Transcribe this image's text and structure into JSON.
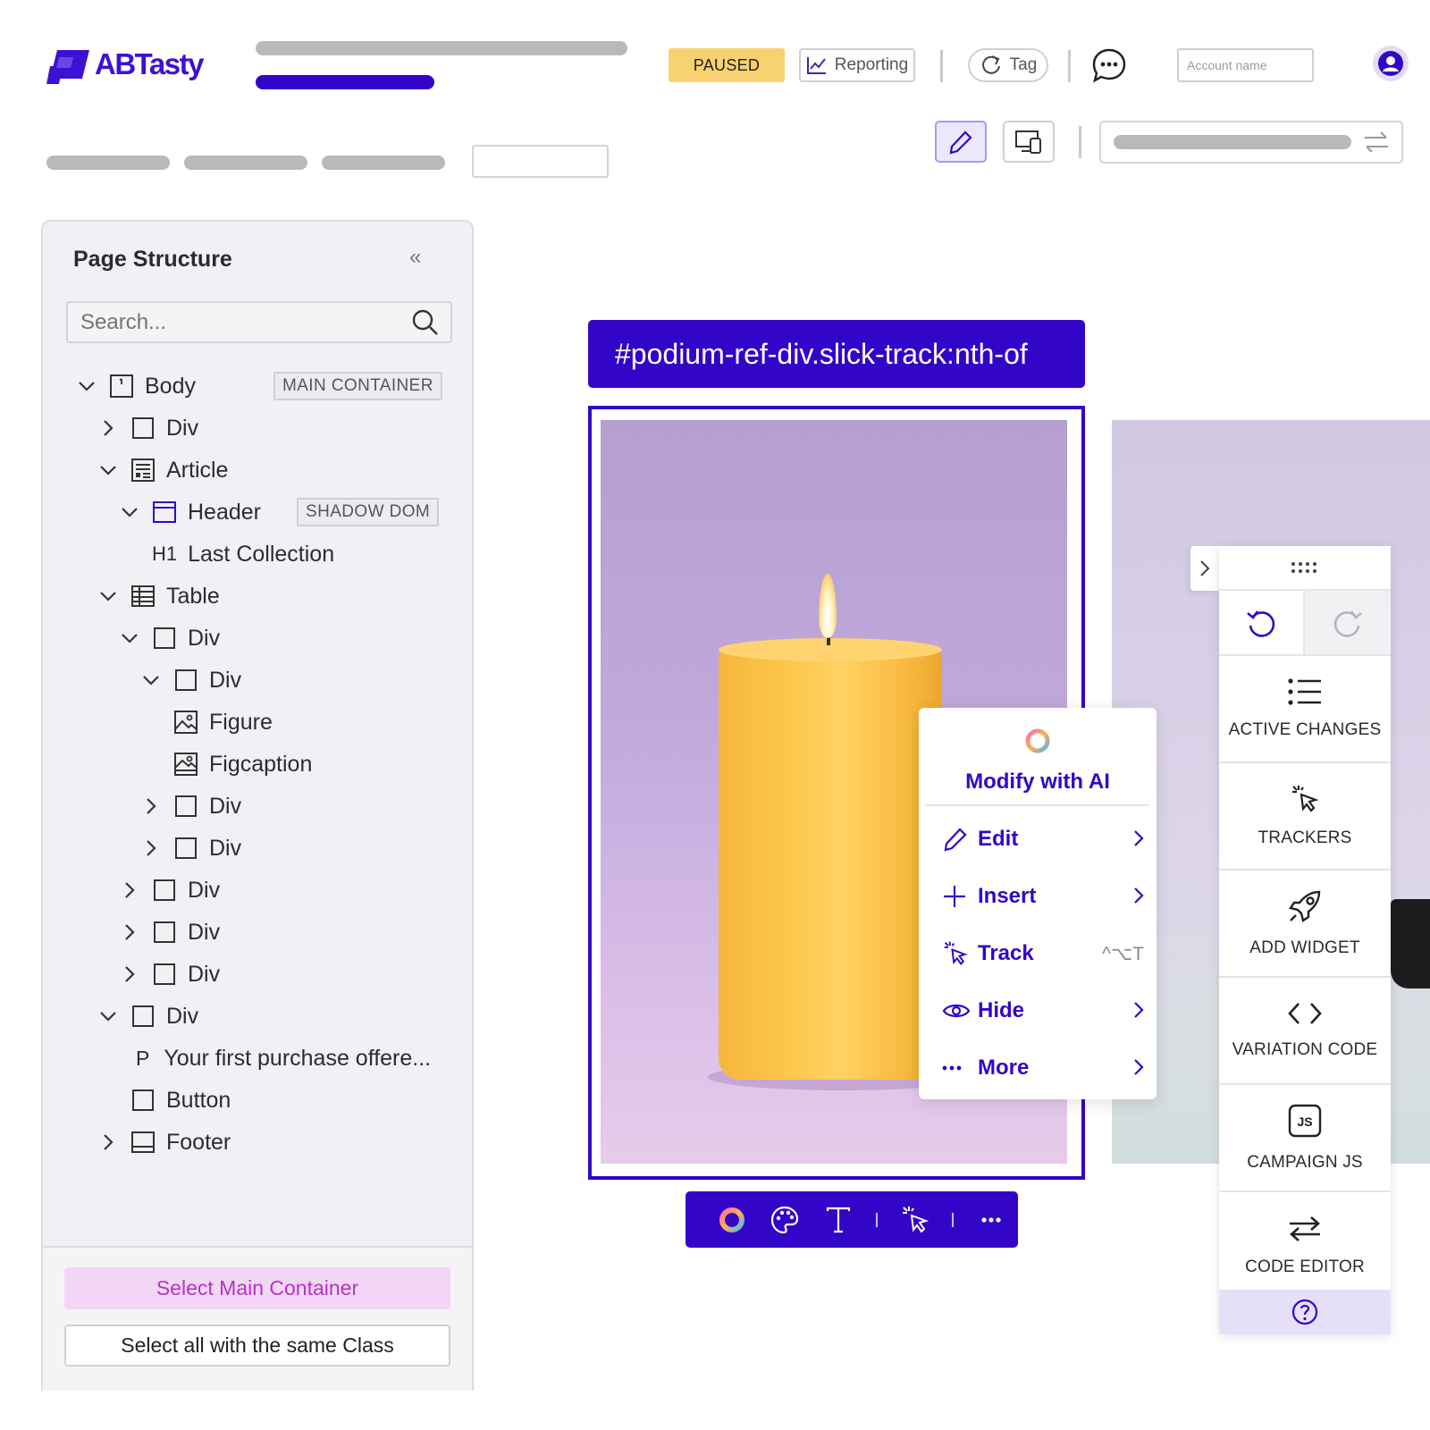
{
  "brand": {
    "name": "ABTasty"
  },
  "header": {
    "status_badge": "PAUSED",
    "reporting_label": "Reporting",
    "tag_label": "Tag",
    "account_placeholder": "Account name"
  },
  "panel": {
    "title": "Page Structure",
    "search_placeholder": "Search...",
    "tree": [
      {
        "label": "Body",
        "badge": "MAIN CONTAINER"
      },
      {
        "label": "Div"
      },
      {
        "label": "Article"
      },
      {
        "label": "Header",
        "badge": "SHADOW DOM"
      },
      {
        "label": "Last Collection",
        "prefix": "H1"
      },
      {
        "label": "Table"
      },
      {
        "label": "Div"
      },
      {
        "label": "Div"
      },
      {
        "label": "Figure"
      },
      {
        "label": "Figcaption"
      },
      {
        "label": "Div"
      },
      {
        "label": "Div"
      },
      {
        "label": "Div"
      },
      {
        "label": "Div"
      },
      {
        "label": "Div"
      },
      {
        "label": "Div"
      },
      {
        "label": "Your first purchase offere...",
        "prefix": "P"
      },
      {
        "label": "Button"
      },
      {
        "label": "Footer"
      }
    ],
    "select_main_label": "Select Main Container",
    "select_class_label": "Select all with the same Class"
  },
  "canvas": {
    "selector": "#podium-ref-div.slick-track:nth-of"
  },
  "context_menu": {
    "ai_label": "Modify with AI",
    "items": [
      {
        "label": "Edit"
      },
      {
        "label": "Insert"
      },
      {
        "label": "Track",
        "shortcut": "^⌥T"
      },
      {
        "label": "Hide"
      },
      {
        "label": "More"
      }
    ]
  },
  "right_sidebar": {
    "items": [
      {
        "label": "ACTIVE CHANGES"
      },
      {
        "label": "TRACKERS"
      },
      {
        "label": "ADD WIDGET"
      },
      {
        "label": "VARIATION CODE"
      },
      {
        "label": "CAMPAIGN JS"
      },
      {
        "label": "CODE EDITOR"
      }
    ]
  },
  "colors": {
    "brand": "#3305c8",
    "paused": "#f8d170",
    "select_main_bg": "#f3d6f5",
    "select_main_text": "#b335c0"
  }
}
